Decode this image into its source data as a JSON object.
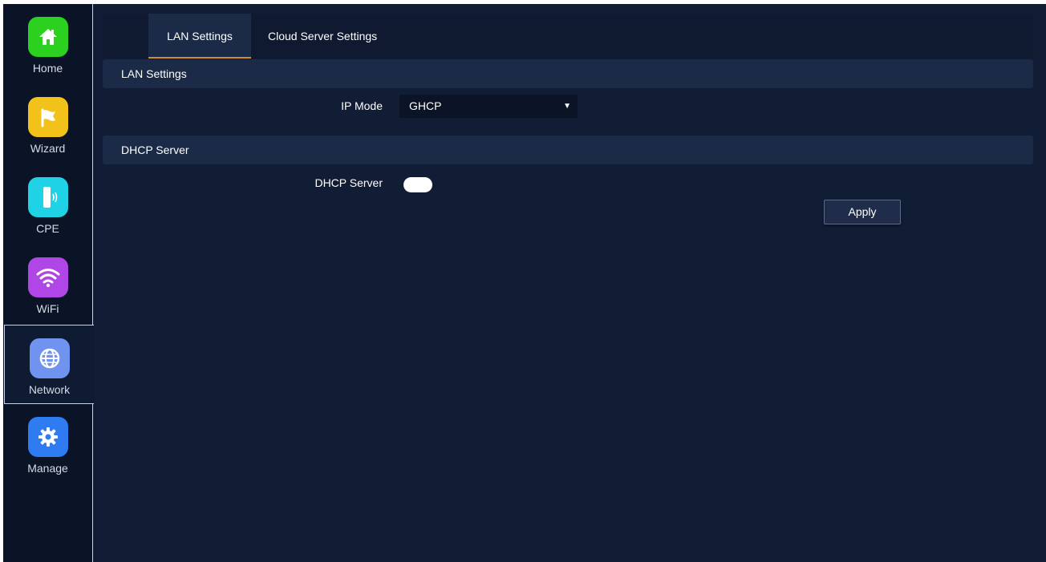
{
  "sidebar": {
    "items": [
      {
        "label": "Home",
        "icon": "home-icon",
        "color": "#2bd11e"
      },
      {
        "label": "Wizard",
        "icon": "flag-icon",
        "color": "#f3c21a"
      },
      {
        "label": "CPE",
        "icon": "cpe-icon",
        "color": "#1fd2e6"
      },
      {
        "label": "WiFi",
        "icon": "wifi-icon",
        "color": "#b146e6"
      },
      {
        "label": "Network",
        "icon": "globe-icon",
        "color": "#6f93ef",
        "active": true
      },
      {
        "label": "Manage",
        "icon": "gear-icon",
        "color": "#2f7cf2"
      }
    ]
  },
  "tabs": [
    {
      "label": "LAN Settings",
      "active": true
    },
    {
      "label": "Cloud Server Settings",
      "active": false
    }
  ],
  "lan_section": {
    "title": "LAN Settings",
    "ip_mode_label": "IP Mode",
    "ip_mode_value": "GHCP"
  },
  "dhcp_section": {
    "title": "DHCP Server",
    "dhcp_server_label": "DHCP Server",
    "dhcp_server_enabled": true
  },
  "apply_label": "Apply",
  "colors": {
    "background": "#111c35",
    "section_bar": "#1b2a46",
    "tab_accent": "#d48c2a"
  }
}
